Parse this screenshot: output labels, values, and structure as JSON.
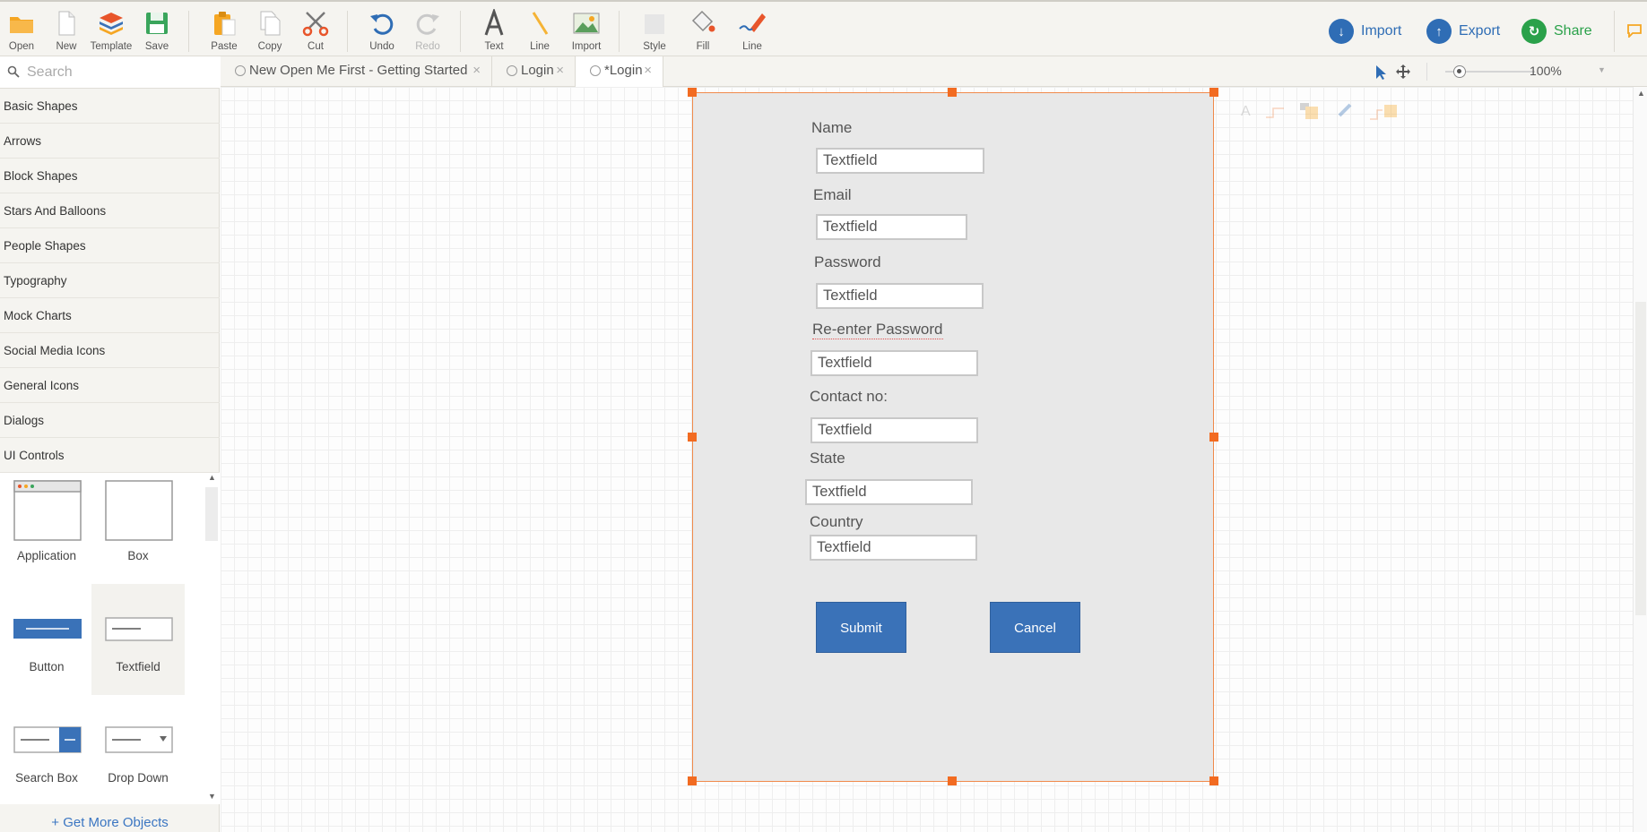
{
  "toolbar": {
    "file": [
      {
        "label": "Open",
        "icon": "folder-icon"
      },
      {
        "label": "New",
        "icon": "new-page-icon"
      },
      {
        "label": "Template",
        "icon": "template-stack-icon"
      },
      {
        "label": "Save",
        "icon": "save-disk-icon"
      }
    ],
    "edit": [
      {
        "label": "Paste",
        "icon": "paste-clipboard-icon"
      },
      {
        "label": "Copy",
        "icon": "copy-pages-icon"
      },
      {
        "label": "Cut",
        "icon": "scissors-icon"
      }
    ],
    "history": [
      {
        "label": "Undo",
        "icon": "undo-icon"
      },
      {
        "label": "Redo",
        "icon": "redo-icon",
        "disabled": true
      }
    ],
    "insert": [
      {
        "label": "Text",
        "icon": "text-a-icon"
      },
      {
        "label": "Line",
        "icon": "line-icon"
      },
      {
        "label": "Import",
        "icon": "image-icon"
      }
    ],
    "format": [
      {
        "label": "Style",
        "icon": "style-swatch-icon"
      },
      {
        "label": "Fill",
        "icon": "paint-bucket-icon"
      },
      {
        "label": "Line",
        "icon": "pencil-line-icon"
      }
    ],
    "actions": [
      {
        "label": "Import",
        "icon": "download-circle-icon",
        "color": "#2f6db5"
      },
      {
        "label": "Export",
        "icon": "upload-circle-icon",
        "color": "#2f6db5"
      },
      {
        "label": "Share",
        "icon": "share-circle-icon",
        "color": "#2aa14a"
      }
    ]
  },
  "sidebar": {
    "search_placeholder": "Search",
    "categories": [
      "Basic Shapes",
      "Arrows",
      "Block Shapes",
      "Stars And Balloons",
      "People Shapes",
      "Typography",
      "Mock Charts",
      "Social Media Icons",
      "General Icons",
      "Dialogs",
      "UI Controls"
    ],
    "shapes": [
      {
        "label": "Application"
      },
      {
        "label": "Box"
      },
      {
        "label": "Button"
      },
      {
        "label": "Textfield"
      },
      {
        "label": "Search Box"
      },
      {
        "label": "Drop Down"
      }
    ],
    "get_more": "+ Get More Objects"
  },
  "tabs": [
    {
      "label": "New Open Me First - Getting Started",
      "active": false
    },
    {
      "label": "Login",
      "active": false
    },
    {
      "label": "*Login",
      "active": true
    }
  ],
  "zoom": {
    "level": "100%"
  },
  "form": {
    "fields": [
      {
        "label": "Name",
        "value": "Textfield"
      },
      {
        "label": "Email",
        "value": "Textfield"
      },
      {
        "label": "Password",
        "value": "Textfield"
      },
      {
        "label": "Re-enter Password",
        "value": "Textfield"
      },
      {
        "label": "Contact no:",
        "value": "Textfield"
      },
      {
        "label": "State",
        "value": "Textfield"
      },
      {
        "label": "Country",
        "value": "Textfield"
      }
    ],
    "submit": "Submit",
    "cancel": "Cancel"
  },
  "colors": {
    "accent": "#3a72b8",
    "selection": "#f26b21",
    "share": "#2aa14a"
  }
}
